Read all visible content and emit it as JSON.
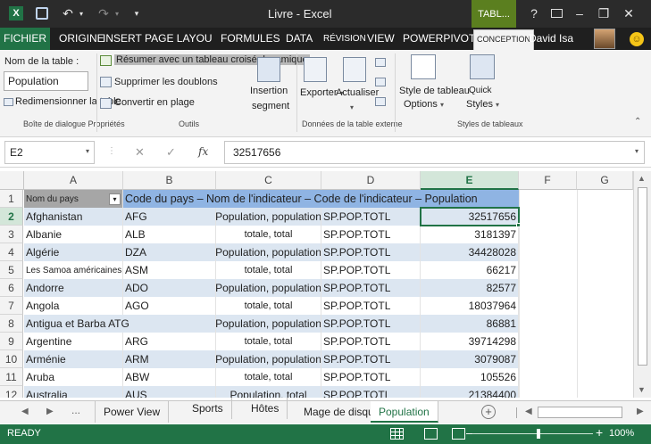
{
  "window": {
    "title": "Livre - Excel",
    "context_tab": "TABL...",
    "help": "?",
    "minimize": "–",
    "restore": "❐",
    "close": "✕"
  },
  "qat": {
    "save": "💾",
    "undo": "↶",
    "redo": "↷"
  },
  "tabs": [
    {
      "label": "FICHIER"
    },
    {
      "label": "ORIGINE"
    },
    {
      "label": "INSERT"
    },
    {
      "label": "PAGE LAYOU"
    },
    {
      "label": "FORMULES"
    },
    {
      "label": "DATA"
    },
    {
      "label": "RÉVISION"
    },
    {
      "label": "VIEW"
    },
    {
      "label": "POWERPIVOT"
    },
    {
      "label": "CONCEPTION"
    }
  ],
  "user": {
    "name": "David Isa"
  },
  "ribbon": {
    "table_name_label": "Nom de la table :",
    "table_name_value": "Population",
    "resize_label": "Redimensionner la table",
    "properties_group": "Boîte de dialogue Propriétés",
    "summarize_label": "Résumer avec un tableau croisé dynamique",
    "remove_dupes_label": "Supprimer les doublons",
    "convert_label": "Convertir en plage",
    "tools_group": "Outils",
    "slicer_label_1": "Insertion",
    "slicer_label_2": "segment",
    "export_label": "Exporter",
    "refresh_label": "Actualiser",
    "external_group": "Données de la table externe",
    "style_options_1": "Style de tableau",
    "style_options_2": "Options",
    "quick_styles_1": "Quick",
    "quick_styles_2": "Styles",
    "styles_group": "Styles de tableaux"
  },
  "formula_bar": {
    "name_box": "E2",
    "cancel": "✕",
    "enter": "✓",
    "fx": "fx",
    "formula": "32517656"
  },
  "columns": [
    "A",
    "B",
    "C",
    "D",
    "E",
    "F",
    "G"
  ],
  "selected_column": "E",
  "header_row": {
    "row_num": "1",
    "a": "Nom du pays",
    "rest": "Code du pays – Nom de l'indicateur – Code de l'indicateur – Population"
  },
  "rows": [
    {
      "n": "2",
      "a": "Afghanistan",
      "b": "AFG",
      "c": "Population, population",
      "d": "SP.POP.TOTL",
      "e": "32517656"
    },
    {
      "n": "3",
      "a": "Albanie",
      "b": "ALB",
      "c": "totale, total",
      "d": "SP.POP.TOTL",
      "e": "3181397"
    },
    {
      "n": "4",
      "a": "Algérie",
      "b": "DZA",
      "c": "Population, population",
      "d": "SP.POP.TOTL",
      "e": "34428028"
    },
    {
      "n": "5",
      "a": "Les Samoa américaines",
      "b": "ASM",
      "c": "totale, total",
      "d": "SP.POP.TOTL",
      "e": "66217"
    },
    {
      "n": "6",
      "a": "Andorre",
      "b": "ADO",
      "c": "Population, population",
      "d": "SP.POP.TOTL",
      "e": "82577"
    },
    {
      "n": "7",
      "a": "Angola",
      "b": "AGO",
      "c": "totale, total",
      "d": "SP.POP.TOTL",
      "e": "18037964"
    },
    {
      "n": "8",
      "a": "Antigua et Barba ATG",
      "b": "",
      "c": "Population, population",
      "d": "SP.POP.TOTL",
      "e": "86881"
    },
    {
      "n": "9",
      "a": "Argentine",
      "b": "ARG",
      "c": "totale, total",
      "d": "SP.POP.TOTL",
      "e": "39714298"
    },
    {
      "n": "10",
      "a": "Arménie",
      "b": "ARM",
      "c": "Population, population",
      "d": "SP.POP.TOTL",
      "e": "3079087"
    },
    {
      "n": "11",
      "a": "Aruba",
      "b": "ABW",
      "c": "totale, total",
      "d": "SP.POP.TOTL",
      "e": "105526"
    },
    {
      "n": "12",
      "a": "Australia",
      "b": "AUS",
      "c": "Population, total",
      "d": "SP.POP.TOTL",
      "e": "21384400"
    }
  ],
  "sheet_tabs": {
    "ellipsis": "...",
    "items": [
      {
        "label": "Power View"
      },
      {
        "label": "Sports"
      },
      {
        "label": "Hôtes"
      },
      {
        "label": "Mage de disque"
      },
      {
        "label": "Population"
      }
    ],
    "add": "+"
  },
  "status": {
    "ready": "READY",
    "zoom": "100%",
    "minus": "–",
    "plus": "+"
  },
  "colors": {
    "excel_green": "#217346",
    "table_header": "#8fb4e3",
    "table_band": "#dce6f1",
    "context_tab": "#5b7f1f"
  }
}
